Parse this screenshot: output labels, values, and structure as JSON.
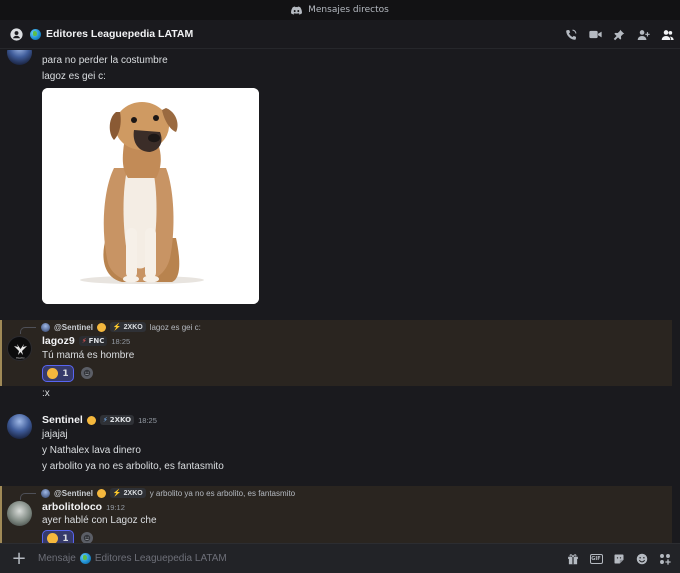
{
  "titlebar": {
    "title": "Mensajes directos"
  },
  "header": {
    "channel_name": "Editores Leaguepedia LATAM"
  },
  "messages": {
    "m1": {
      "line1": "para no perder la costumbre",
      "line2": "lagoz es gei c:"
    },
    "reply1": {
      "author": "@Sentinel",
      "tag": "2XKO",
      "text": "lagoz es gei c:"
    },
    "m2": {
      "author": "lagoz9",
      "tag": "FNC",
      "time": "18:25",
      "text": "Tú mamá es hombre",
      "reaction_count": "1"
    },
    "m3": {
      "text": ":x"
    },
    "m4": {
      "author": "Sentinel",
      "tag": "2XKO",
      "time": "18:25",
      "line1": "jajajaj",
      "line2": "y Nathalex lava dinero",
      "line3": "y arbolito ya no es arbolito, es fantasmito"
    },
    "reply2": {
      "author": "@Sentinel",
      "tag": "2XKO",
      "text": "y arbolito ya no es arbolito, es fantasmito"
    },
    "m5": {
      "author": "arbolitoloco",
      "time": "19:12",
      "text": "ayer hablé con Lagoz che",
      "reaction_count": "1"
    }
  },
  "composer": {
    "placeholder_prefix": "Mensaje",
    "placeholder_channel": "Editores Leaguepedia LATAM"
  },
  "icons": {
    "header": [
      "friend-icon",
      "globe-icon",
      "call-icon",
      "video-icon",
      "pin-icon",
      "add-member-icon",
      "members-icon"
    ],
    "composer": [
      "plus-icon",
      "gift-icon",
      "gif-icon",
      "sticker-icon",
      "emoji-icon",
      "apps-icon"
    ]
  },
  "colors": {
    "highlight_bg": "#2a2520",
    "highlight_border": "#a08a57",
    "reaction_bg": "#363a6b",
    "reaction_border": "#5865f2"
  }
}
